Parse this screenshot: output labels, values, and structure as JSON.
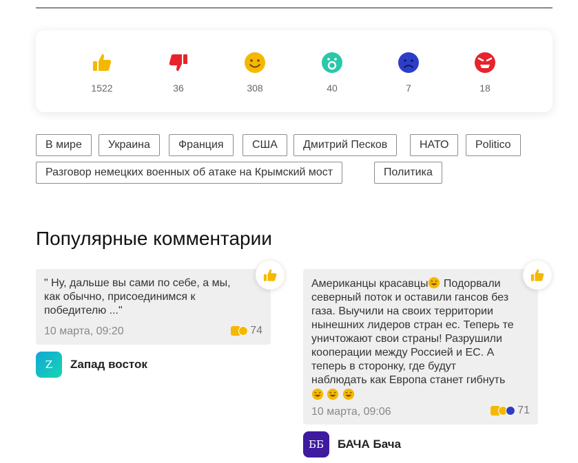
{
  "reactions": [
    {
      "name": "like",
      "count": "1522",
      "color": "#f5b800"
    },
    {
      "name": "dislike",
      "count": "36",
      "color": "#e8232b"
    },
    {
      "name": "smile",
      "count": "308",
      "color": "#f5b800"
    },
    {
      "name": "surprise",
      "count": "40",
      "color": "#28c8a8"
    },
    {
      "name": "sad",
      "count": "7",
      "color": "#2c3ec8"
    },
    {
      "name": "angry",
      "count": "18",
      "color": "#e8232b"
    }
  ],
  "tags": [
    "В мире",
    "Украина",
    "Франция",
    "США",
    "Дмитрий Песков",
    "НАТО",
    "Politico",
    "Разговор немецких военных об атаке на Крымский мост",
    "Политика"
  ],
  "section_title": "Популярные комментарии",
  "comments": [
    {
      "lines": [
        "\" Ну, дальше вы сами по себе, а мы,",
        "как обычно, присоединимся к",
        "победителю ...\""
      ],
      "date": "10 марта, 09:20",
      "reaction_count": "74",
      "author": "Zапад восток",
      "avatar_letter": "Z",
      "avatar_color": "#12b8c8"
    },
    {
      "lines": [
        "Американцы красавцы",
        "Подорвали",
        "северный поток и оставили гансов без",
        "газа. Выучили на своих территории",
        "нынешних лидеров стран ес. Теперь те",
        "уничтожают свои страны! Разрушили",
        "кооперации между Россией и ЕС. А",
        "теперь в сторонку, где будут",
        "наблюдать как Европа станет гибнуть"
      ],
      "date": "10 марта, 09:06",
      "reaction_count": "71",
      "author": "БАЧА Бача",
      "avatar_letter": "ББ",
      "avatar_color": "#3d1a9e"
    }
  ]
}
